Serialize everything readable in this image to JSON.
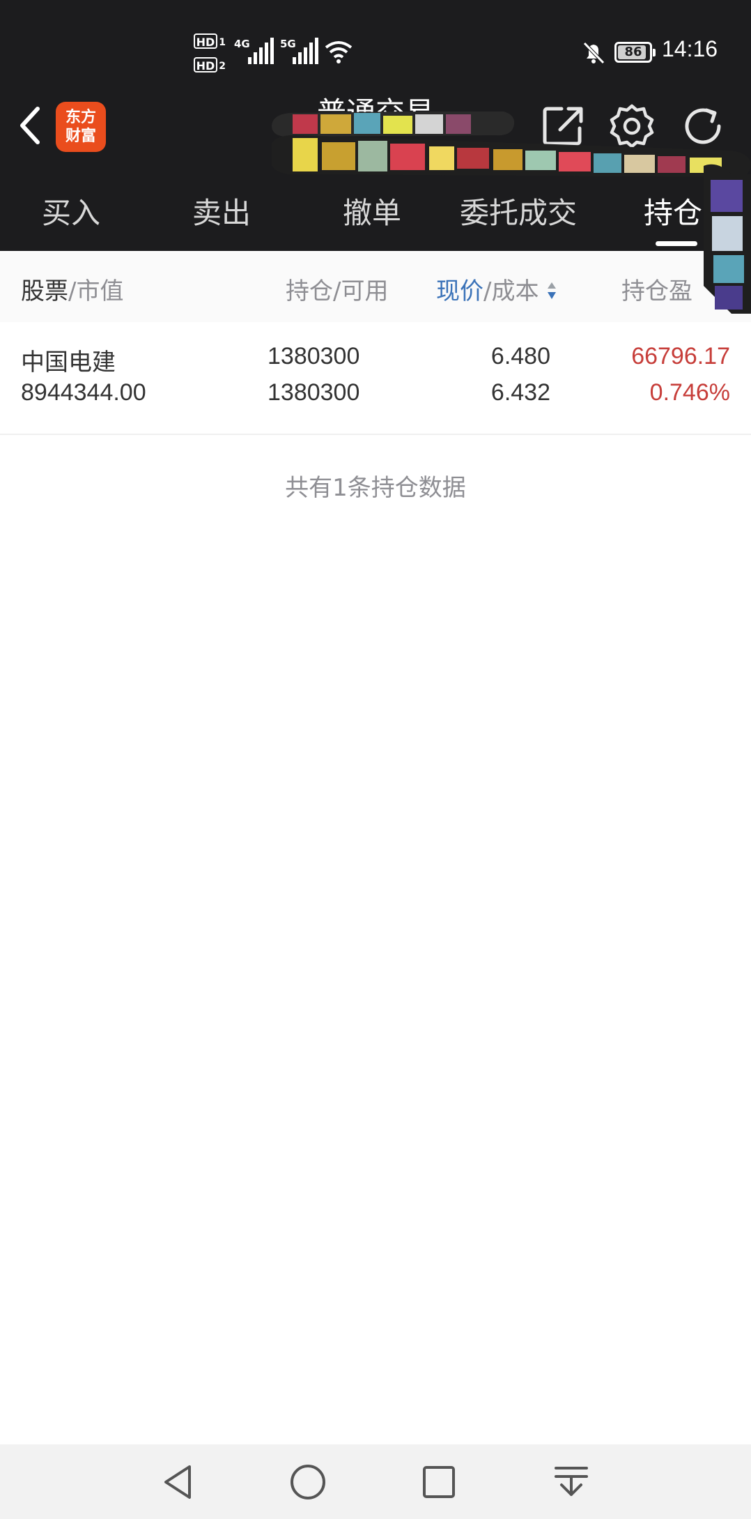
{
  "status_bar": {
    "hd1": "HD",
    "hd1_sub": "1",
    "hd2": "HD",
    "hd2_sub": "2",
    "net1": "4G",
    "net2": "5G",
    "battery": "86",
    "time": "14:16"
  },
  "header": {
    "logo_line1": "东方",
    "logo_line2": "财富",
    "title": "普通交易"
  },
  "tabs": [
    {
      "label": "买入",
      "active": false
    },
    {
      "label": "卖出",
      "active": false
    },
    {
      "label": "撤单",
      "active": false
    },
    {
      "label": "委托成交",
      "active": false
    },
    {
      "label": "持仓",
      "active": true
    }
  ],
  "columns": {
    "col1_main": "股票",
    "col1_sub": "/市值",
    "col2": "持仓/可用",
    "col3_main": "现价",
    "col3_sub": "/成本",
    "col4": "持仓盈"
  },
  "holdings": [
    {
      "name": "中国电建",
      "market_value": "8944344.00",
      "position": "1380300",
      "available": "1380300",
      "price": "6.480",
      "cost": "6.432",
      "profit": "66796.17",
      "profit_pct": "0.746%"
    }
  ],
  "summary": "共有1条持仓数据",
  "colors": {
    "top_bg": "#1c1c1e",
    "logo": "#ea4d1d",
    "accent_blue": "#3a72b8",
    "profit_red": "#c73e3a"
  },
  "icons": [
    "back-icon",
    "share-icon",
    "settings-icon",
    "refresh-icon",
    "sort-icon",
    "nav-back-icon",
    "nav-home-icon",
    "nav-recent-icon",
    "nav-down-icon"
  ]
}
